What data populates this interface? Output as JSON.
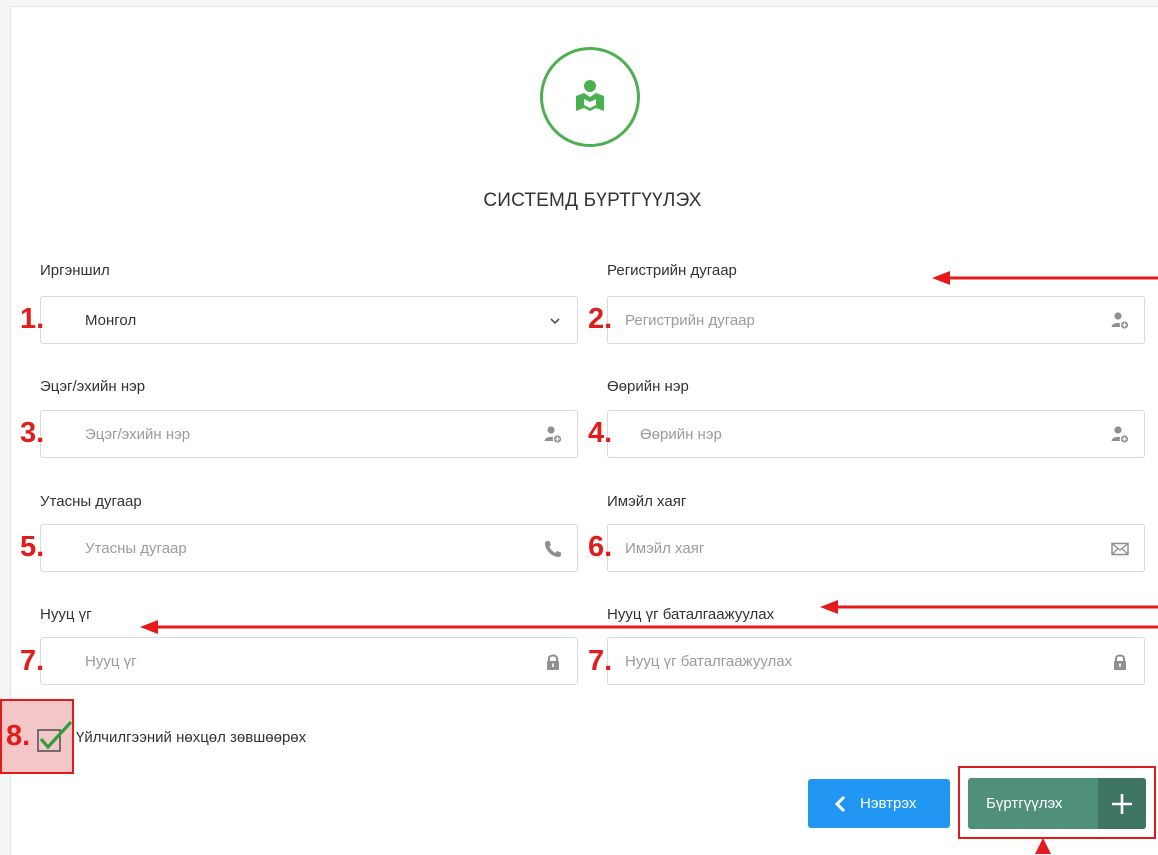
{
  "form": {
    "title": "СИСТЕМД БҮРТГҮҮЛЭХ",
    "fields": {
      "nationality": {
        "label": "Иргэншил",
        "value": "Монгол"
      },
      "register": {
        "label": "Регистрийн дугаар",
        "placeholder": "Регистрийн дугаар"
      },
      "parent_name": {
        "label": "Эцэг/эхийн нэр",
        "placeholder": "Эцэг/эхийн нэр"
      },
      "own_name": {
        "label": "Өөрийн нэр",
        "placeholder": "Өөрийн нэр"
      },
      "phone": {
        "label": "Утасны дугаар",
        "placeholder": "Утасны дугаар"
      },
      "email": {
        "label": "Имэйл хаяг",
        "placeholder": "Имэйл хаяг"
      },
      "password": {
        "label": "Нууц үг",
        "placeholder": "Нууц үг"
      },
      "password_confirm": {
        "label": "Нууц үг баталгаажуулах",
        "placeholder": "Нууц үг баталгаажуулах"
      }
    },
    "terms_label": "Үйлчилгээний нөхцөл зөвшөөрөх",
    "terms_checked": true,
    "login_button": "Нэвтрэх",
    "register_button": "Бүртгүүлэх"
  },
  "annotations": {
    "n1": "1.",
    "n2": "2.",
    "n3": "3.",
    "n4": "4.",
    "n5": "5.",
    "n6": "6.",
    "n7a": "7.",
    "n7b": "7.",
    "n8": "8."
  },
  "colors": {
    "accent_green": "#4caf50",
    "login_blue": "#2196f3",
    "register_green": "#50907a",
    "annotation_red": "#e31b1b"
  },
  "icons": {
    "logo": "reader-person-icon",
    "select": "chevron-down-icon",
    "register": "user-plus-icon",
    "parent_name": "user-plus-icon",
    "own_name": "user-plus-icon",
    "phone": "phone-icon",
    "email": "envelope-icon",
    "password": "lock-icon",
    "password_confirm": "lock-icon",
    "checkbox": "checkmark-icon",
    "login": "chevron-left-icon",
    "register_button": "plus-icon"
  }
}
